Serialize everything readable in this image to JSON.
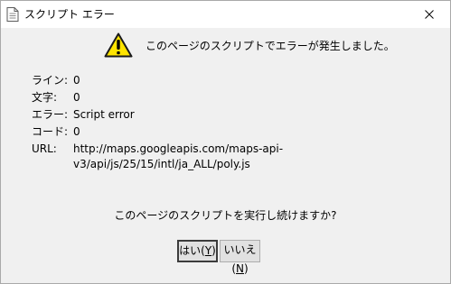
{
  "window": {
    "title": "スクリプト エラー"
  },
  "message": {
    "text": "このページのスクリプトでエラーが発生しました。"
  },
  "details": {
    "line": {
      "label": "ライン:",
      "value": "0"
    },
    "char": {
      "label": "文字:",
      "value": "0"
    },
    "error": {
      "label": "エラー:",
      "value": "Script error"
    },
    "code": {
      "label": "コード:",
      "value": "0"
    },
    "url": {
      "label": "URL:",
      "lines": [
        "http://maps.googleapis.com/maps-api-",
        "v3/api/js/25/15/intl/ja_ALL/poly.js"
      ]
    }
  },
  "prompt": {
    "question": "このページのスクリプトを実行し続けますか?"
  },
  "buttons": {
    "yes": {
      "label": "はい(",
      "accel": "Y",
      "close": ")"
    },
    "no": {
      "label": "いいえ(",
      "accel": "N",
      "close": ")"
    }
  },
  "icons": {
    "title": "document-icon",
    "close": "close-icon",
    "warning": "warning-icon"
  },
  "colors": {
    "warning_fill": "#ffe400",
    "title_bar": "#ffffff",
    "dialog_bg": "#f0f0f0",
    "button_bg": "#e1e1e1"
  }
}
